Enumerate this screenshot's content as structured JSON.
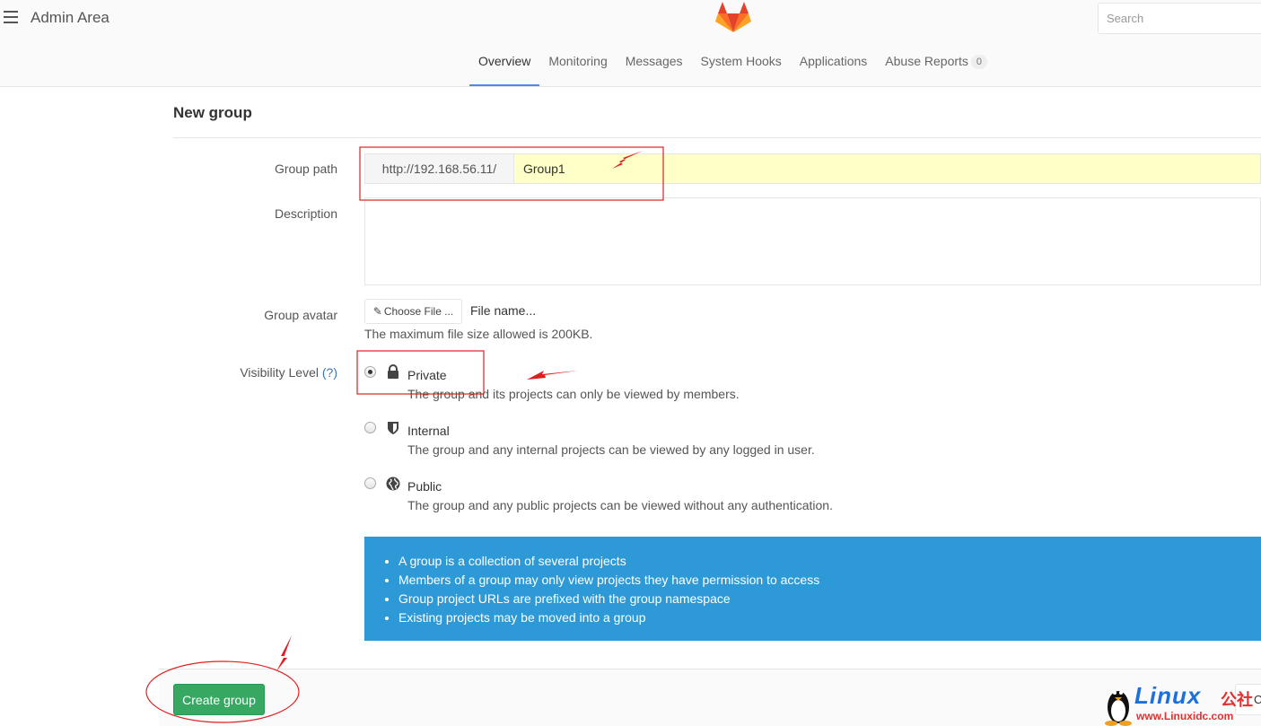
{
  "header": {
    "title": "Admin Area",
    "search_placeholder": "Search"
  },
  "nav": {
    "tabs": [
      {
        "label": "Overview",
        "active": true
      },
      {
        "label": "Monitoring"
      },
      {
        "label": "Messages"
      },
      {
        "label": "System Hooks"
      },
      {
        "label": "Applications"
      },
      {
        "label": "Abuse Reports",
        "badge": "0"
      }
    ]
  },
  "form": {
    "page_title": "New group",
    "group_path": {
      "label": "Group path",
      "prefix": "http://192.168.56.11/",
      "value": "Group1",
      "highlight_color": "#ffffc8"
    },
    "description": {
      "label": "Description",
      "value": ""
    },
    "avatar": {
      "label": "Group avatar",
      "choose_button": "Choose File ...",
      "file_name": "File name...",
      "help": "The maximum file size allowed is 200KB."
    },
    "visibility": {
      "label": "Visibility Level",
      "help_link": "(?)",
      "options": [
        {
          "title": "Private",
          "icon": "lock-icon",
          "checked": true,
          "desc": "The group and its projects can only be viewed by members."
        },
        {
          "title": "Internal",
          "icon": "shield-icon",
          "checked": false,
          "desc": "The group and any internal projects can be viewed by any logged in user."
        },
        {
          "title": "Public",
          "icon": "globe-icon",
          "checked": false,
          "desc": "The group and any public projects can be viewed without any authentication."
        }
      ]
    },
    "info": {
      "bg_color": "#2d9ad7",
      "items": [
        "A group is a collection of several projects",
        "Members of a group may only view projects they have permission to access",
        "Group project URLs are prefixed with the group namespace",
        "Existing projects may be moved into a group"
      ]
    },
    "actions": {
      "create_label": "Create group",
      "create_color": "#36a862",
      "cancel_label": "Cancel"
    }
  },
  "watermark": {
    "text": "Linux",
    "cn": "公社",
    "url": "www.Linuxidc.com"
  }
}
